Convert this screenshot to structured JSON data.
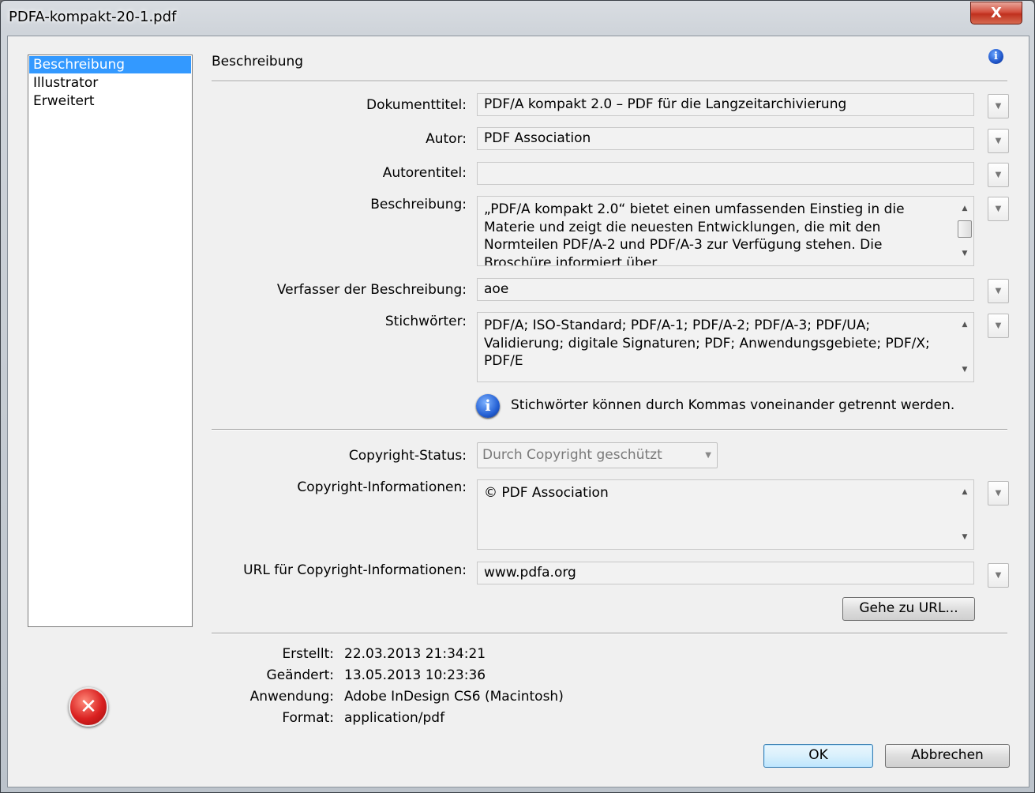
{
  "window": {
    "title": "PDFA-kompakt-20-1.pdf",
    "close_label": "X"
  },
  "sidebar": {
    "items": [
      {
        "label": "Beschreibung",
        "selected": true
      },
      {
        "label": "Illustrator",
        "selected": false
      },
      {
        "label": "Erweitert",
        "selected": false
      }
    ]
  },
  "section": {
    "title": "Beschreibung"
  },
  "fields": {
    "document_title": {
      "label": "Dokumenttitel:",
      "value": "PDF/A kompakt 2.0 – PDF für die Langzeitarchivierung"
    },
    "author": {
      "label": "Autor:",
      "value": "PDF Association"
    },
    "author_title": {
      "label": "Autorentitel:",
      "value": ""
    },
    "description": {
      "label": "Beschreibung:",
      "value": "„PDF/A kompakt 2.0“ bietet einen umfassenden Einstieg in die Materie und zeigt die neuesten Entwicklungen, die mit den Normteilen PDF/A-2 und PDF/A-3 zur Verfügung stehen. Die Broschüre informiert über"
    },
    "description_writer": {
      "label": "Verfasser der Beschreibung:",
      "value": "aoe"
    },
    "keywords": {
      "label": "Stichwörter:",
      "value": "PDF/A; ISO-Standard; PDF/A-1; PDF/A-2; PDF/A-3; PDF/UA; Validierung; digitale Signaturen; PDF; Anwendungsgebiete; PDF/X; PDF/E"
    },
    "keywords_hint": "Stichwörter können durch Kommas voneinander getrennt werden.",
    "copyright_status": {
      "label": "Copyright-Status:",
      "value": "Durch Copyright geschützt"
    },
    "copyright_info": {
      "label": "Copyright-Informationen:",
      "value": "© PDF Association"
    },
    "copyright_url": {
      "label": "URL für Copyright-Informationen:",
      "value": "www.pdfa.org"
    }
  },
  "buttons": {
    "go_to_url": "Gehe zu URL...",
    "ok": "OK",
    "cancel": "Abbrechen"
  },
  "metadata": {
    "created": {
      "label": "Erstellt:",
      "value": "22.03.2013 21:34:21"
    },
    "modified": {
      "label": "Geändert:",
      "value": "13.05.2013 10:23:36"
    },
    "application": {
      "label": "Anwendung:",
      "value": "Adobe InDesign CS6 (Macintosh)"
    },
    "format": {
      "label": "Format:",
      "value": "application/pdf"
    }
  },
  "icons": {
    "close": "close-icon",
    "info": "info-icon",
    "error": "error-icon",
    "dropdown": "chevron-down-icon"
  }
}
